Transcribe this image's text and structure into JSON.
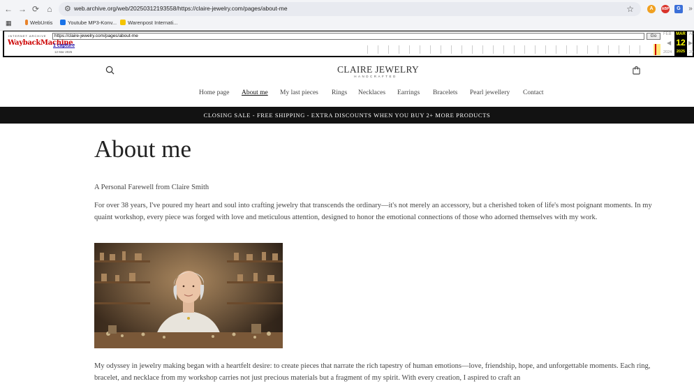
{
  "browser": {
    "url": "web.archive.org/web/20250312193558/https://claire-jewelry.com/pages/about-me",
    "bookmarks": [
      "WebUntis",
      "Youtube MP3-Konv...",
      "Warenpost Internati..."
    ],
    "ext_labels": [
      "A",
      "ABP",
      "G"
    ]
  },
  "wayback": {
    "brand_small": "INTERNET ARCHIVE",
    "brand": "WaybackMachine",
    "url_value": "https://claire-jewelry.com/pages/about-me",
    "go": "Go",
    "captures": "1 capture",
    "capture_date": "12 Mar 2025",
    "prev_month": "FEB",
    "cur_month": "MAR",
    "next_month": "AP",
    "day": "12",
    "prev_year": "2024",
    "cur_year": "2025",
    "next_year": "20"
  },
  "site": {
    "logo_main": "CLAIRE JEWELRY",
    "logo_sub": "HANDCRAFTED",
    "menu": [
      "Home page",
      "About me",
      "My last pieces",
      "Rings",
      "Necklaces",
      "Earrings",
      "Bracelets",
      "Pearl jewellery",
      "Contact"
    ],
    "banner": "CLOSING SALE - FREE SHIPPING - EXTRA DISCOUNTS WHEN YOU BUY 2+ MORE PRODUCTS"
  },
  "page": {
    "title": "About me",
    "subtitle": "A Personal Farewell from Claire Smith",
    "para1": "For over 38 years, I've poured my heart and soul into crafting jewelry that transcends the ordinary—it's not merely an accessory, but a cherished token of life's most poignant moments. In my quaint workshop, every piece was forged with love and meticulous attention, designed to honor the emotional connections of those who adorned themselves with my work.",
    "para2": "My odyssey in jewelry making began with a heartfelt desire: to create pieces that narrate the rich tapestry of human emotions—love, friendship, hope, and unforgettable moments. Each ring, bracelet, and necklace from my workshop carries not just precious materials but a fragment of my spirit. With every creation, I aspired to craft an"
  },
  "colors": {
    "banner_bg": "#121212",
    "wayback_red": "#c00000",
    "calendar_yellow": "#ffff00"
  }
}
